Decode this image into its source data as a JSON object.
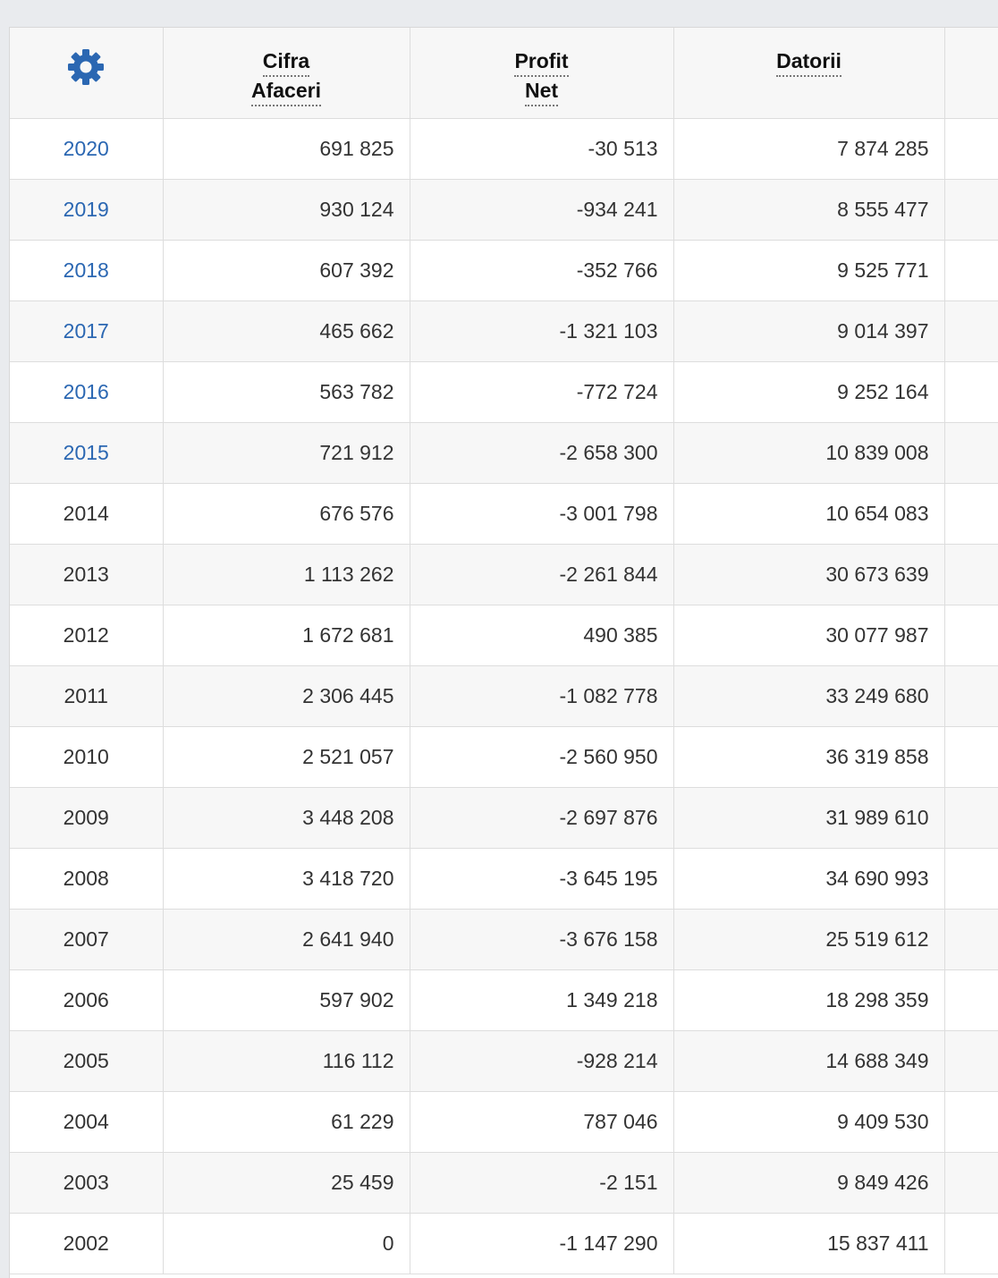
{
  "table": {
    "headers": {
      "settings_icon": "gear-icon",
      "cifra_afaceri": [
        "Cifra",
        "Afaceri"
      ],
      "profit_net": [
        "Profit",
        "Net"
      ],
      "datorii": [
        "Datorii"
      ]
    },
    "rows": [
      {
        "year": "2020",
        "linked": true,
        "cifra_afaceri": "691 825",
        "profit_net": "-30 513",
        "datorii": "7 874 285"
      },
      {
        "year": "2019",
        "linked": true,
        "cifra_afaceri": "930 124",
        "profit_net": "-934 241",
        "datorii": "8 555 477"
      },
      {
        "year": "2018",
        "linked": true,
        "cifra_afaceri": "607 392",
        "profit_net": "-352 766",
        "datorii": "9 525 771"
      },
      {
        "year": "2017",
        "linked": true,
        "cifra_afaceri": "465 662",
        "profit_net": "-1 321 103",
        "datorii": "9 014 397"
      },
      {
        "year": "2016",
        "linked": true,
        "cifra_afaceri": "563 782",
        "profit_net": "-772 724",
        "datorii": "9 252 164"
      },
      {
        "year": "2015",
        "linked": true,
        "cifra_afaceri": "721 912",
        "profit_net": "-2 658 300",
        "datorii": "10 839 008"
      },
      {
        "year": "2014",
        "linked": false,
        "cifra_afaceri": "676 576",
        "profit_net": "-3 001 798",
        "datorii": "10 654 083"
      },
      {
        "year": "2013",
        "linked": false,
        "cifra_afaceri": "1 113 262",
        "profit_net": "-2 261 844",
        "datorii": "30 673 639"
      },
      {
        "year": "2012",
        "linked": false,
        "cifra_afaceri": "1 672 681",
        "profit_net": "490 385",
        "datorii": "30 077 987"
      },
      {
        "year": "2011",
        "linked": false,
        "cifra_afaceri": "2 306 445",
        "profit_net": "-1 082 778",
        "datorii": "33 249 680"
      },
      {
        "year": "2010",
        "linked": false,
        "cifra_afaceri": "2 521 057",
        "profit_net": "-2 560 950",
        "datorii": "36 319 858"
      },
      {
        "year": "2009",
        "linked": false,
        "cifra_afaceri": "3 448 208",
        "profit_net": "-2 697 876",
        "datorii": "31 989 610"
      },
      {
        "year": "2008",
        "linked": false,
        "cifra_afaceri": "3 418 720",
        "profit_net": "-3 645 195",
        "datorii": "34 690 993"
      },
      {
        "year": "2007",
        "linked": false,
        "cifra_afaceri": "2 641 940",
        "profit_net": "-3 676 158",
        "datorii": "25 519 612"
      },
      {
        "year": "2006",
        "linked": false,
        "cifra_afaceri": "597 902",
        "profit_net": "1 349 218",
        "datorii": "18 298 359"
      },
      {
        "year": "2005",
        "linked": false,
        "cifra_afaceri": "116 112",
        "profit_net": "-928 214",
        "datorii": "14 688 349"
      },
      {
        "year": "2004",
        "linked": false,
        "cifra_afaceri": "61 229",
        "profit_net": "787 046",
        "datorii": "9 409 530"
      },
      {
        "year": "2003",
        "linked": false,
        "cifra_afaceri": "25 459",
        "profit_net": "-2 151",
        "datorii": "9 849 426"
      },
      {
        "year": "2002",
        "linked": false,
        "cifra_afaceri": "0",
        "profit_net": "-1 147 290",
        "datorii": "15 837 411"
      }
    ]
  },
  "colors": {
    "link": "#2b67b2",
    "gear": "#2b67b2",
    "text": "#333333",
    "header_text": "#111111",
    "row_alt": "#f7f7f7",
    "page_bg": "#e9ebee"
  }
}
